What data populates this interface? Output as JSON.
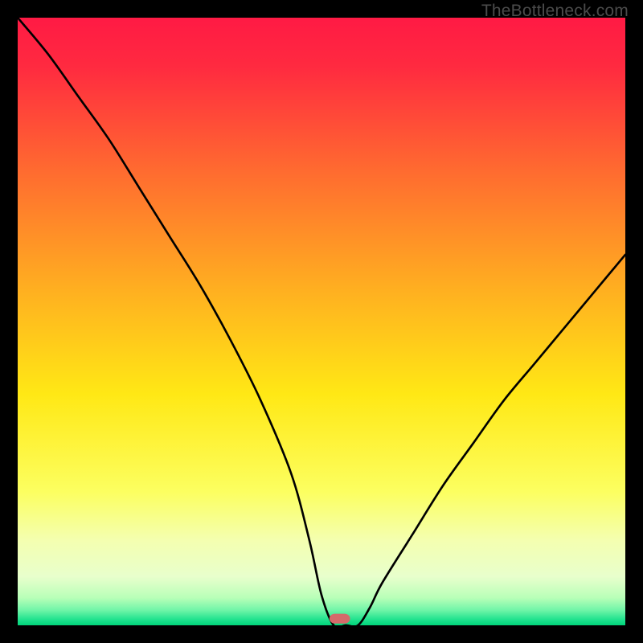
{
  "watermark": "TheBottleneck.com",
  "chart_data": {
    "type": "line",
    "title": "",
    "xlabel": "",
    "ylabel": "",
    "xlim": [
      0,
      100
    ],
    "ylim": [
      0,
      100
    ],
    "series": [
      {
        "name": "bottleneck-curve",
        "x": [
          0,
          5,
          10,
          15,
          20,
          25,
          30,
          35,
          40,
          45,
          48,
          50,
          52,
          54,
          56,
          58,
          60,
          65,
          70,
          75,
          80,
          85,
          90,
          95,
          100
        ],
        "y": [
          100,
          94,
          87,
          80,
          72,
          64,
          56,
          47,
          37,
          25,
          14,
          5,
          0,
          0,
          0,
          3,
          7,
          15,
          23,
          30,
          37,
          43,
          49,
          55,
          61
        ]
      }
    ],
    "marker": {
      "x": 53,
      "y": 0,
      "color": "#d46a6a"
    },
    "background": {
      "stops": [
        {
          "pos": 0.0,
          "color": "#ff1a44"
        },
        {
          "pos": 0.08,
          "color": "#ff2a40"
        },
        {
          "pos": 0.25,
          "color": "#ff6a30"
        },
        {
          "pos": 0.45,
          "color": "#ffb020"
        },
        {
          "pos": 0.62,
          "color": "#ffe815"
        },
        {
          "pos": 0.78,
          "color": "#fcff60"
        },
        {
          "pos": 0.86,
          "color": "#f4ffb0"
        },
        {
          "pos": 0.92,
          "color": "#e8ffcc"
        },
        {
          "pos": 0.955,
          "color": "#b8ffb8"
        },
        {
          "pos": 0.975,
          "color": "#70f5a8"
        },
        {
          "pos": 0.99,
          "color": "#22e38f"
        },
        {
          "pos": 1.0,
          "color": "#00d47a"
        }
      ]
    }
  }
}
